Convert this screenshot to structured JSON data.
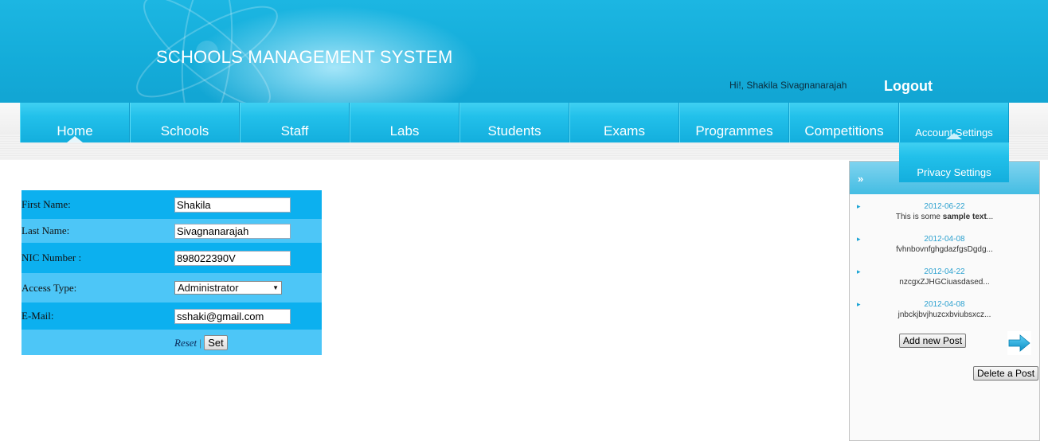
{
  "header": {
    "title": "SCHOOLS MANAGEMENT SYSTEM",
    "greeting": "Hi!, Shakila Sivagnanarajah",
    "logout": "Logout"
  },
  "nav": {
    "items": [
      {
        "label": "Home"
      },
      {
        "label": "Schools"
      },
      {
        "label": "Staff"
      },
      {
        "label": "Labs"
      },
      {
        "label": "Students"
      },
      {
        "label": "Exams"
      },
      {
        "label": "Programmes"
      },
      {
        "label": "Competitions"
      },
      {
        "label": "Account Settings"
      }
    ],
    "dropdown": {
      "label": "Privacy Settings"
    }
  },
  "form": {
    "first_name": {
      "label": "First Name:",
      "value": "Shakila"
    },
    "last_name": {
      "label": "Last Name:",
      "value": "Sivagnanarajah"
    },
    "nic": {
      "label": "NIC Number :",
      "value": "898022390V"
    },
    "access_type": {
      "label": "Access Type:",
      "value": "Administrator"
    },
    "email": {
      "label": "E-Mail:",
      "value": "sshaki@gmail.com"
    },
    "reset": "Reset",
    "separator": "|",
    "set": "Set"
  },
  "panel": {
    "posts": [
      {
        "date": "2012-06-22",
        "snippet_pre": "This is some ",
        "snippet_bold": "sample text",
        "snippet_post": "..."
      },
      {
        "date": "2012-04-08",
        "snippet_pre": "fvhnbovnfghgdazfgsDgdg...",
        "snippet_bold": "",
        "snippet_post": ""
      },
      {
        "date": "2012-04-22",
        "snippet_pre": "nzcgxZJHGCiuasdased...",
        "snippet_bold": "",
        "snippet_post": ""
      },
      {
        "date": "2012-04-08",
        "snippet_pre": "jnbckjbvjhuzcxbviubsxcz...",
        "snippet_bold": "",
        "snippet_post": ""
      }
    ],
    "add_post": "Add new Post",
    "delete_post": "Delete a Post"
  },
  "colors": {
    "header": "#14acd9",
    "nav": "#22c0ea",
    "form_row_dark": "#0cb0ef",
    "form_row_light": "#4dc6f7"
  }
}
